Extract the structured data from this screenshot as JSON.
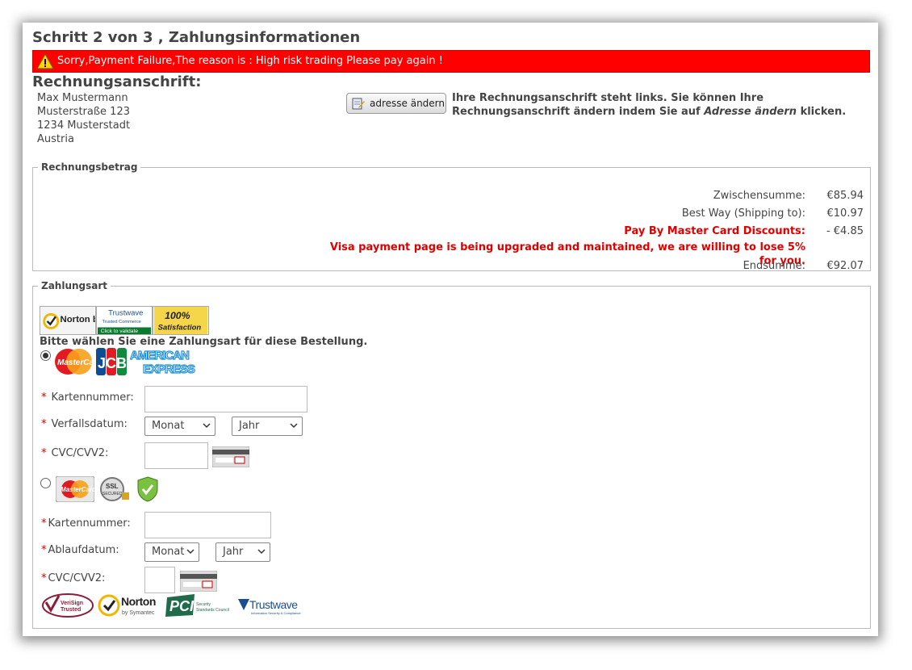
{
  "header": {
    "title": "Schritt 2 von 3 , Zahlungsinformationen"
  },
  "alert": {
    "message": "Sorry,Payment Failure,The reason is : High risk trading Please pay again !"
  },
  "billing": {
    "heading": "Rechnungsanschrift:",
    "address": [
      "Max Mustermann",
      "Musterstraße 123",
      "1234 Musterstadt",
      "Austria"
    ],
    "change_button": "adresse ändern",
    "note_before": "Ihre Rechnungsanschrift steht links. Sie können Ihre Rechnungsanschrift ändern indem Sie auf ",
    "note_link": "Adresse ändern",
    "note_after": " klicken."
  },
  "totals": {
    "legend": "Rechnungsbetrag",
    "subtotal_label": "Zwischensumme:",
    "subtotal_value": "€85.94",
    "shipping_label": "Best Way (Shipping to):",
    "shipping_value": "€10.97",
    "discount_label": "Pay By Master Card Discounts:",
    "discount_value": "- €4.85",
    "discount_note": "Visa payment page is being upgraded and maintained, we are willing to lose 5% for you.",
    "total_label": "Endsumme:",
    "total_value": "€92.07"
  },
  "payment": {
    "legend": "Zahlungsart",
    "badges": [
      "Norton by Symantec",
      "Trustwave Trusted Commerce Click to validate",
      "100% Satisfaction"
    ],
    "prompt": "Bitte wählen Sie eine Zahlungsart für diese Bestellung.",
    "option1": {
      "selected": true,
      "brands": [
        "MasterCard",
        "JCB",
        "AMERICAN EXPRESS"
      ],
      "card_label": "Kartennummer:",
      "expiry_label": "Verfallsdatum:",
      "month": "Monat",
      "year": "Jahr",
      "cvc_label": "CVC/CVV2:"
    },
    "option2": {
      "selected": false,
      "brands": [
        "MasterCard",
        "SSL Secured",
        "Verified"
      ],
      "card_label": "Kartennummer:",
      "expiry_label": "Ablaufdatum:",
      "month": "Monat",
      "year": "Jahr",
      "cvc_label": "CVC/CVV2:"
    },
    "trust_logos": [
      "VeriSign Trusted",
      "Norton by Symantec",
      "PCI Security Standards Council",
      "Trustwave"
    ]
  },
  "colors": {
    "alert_bg": "#ff0000",
    "discount_red": "#e00000",
    "text": "#444444"
  }
}
